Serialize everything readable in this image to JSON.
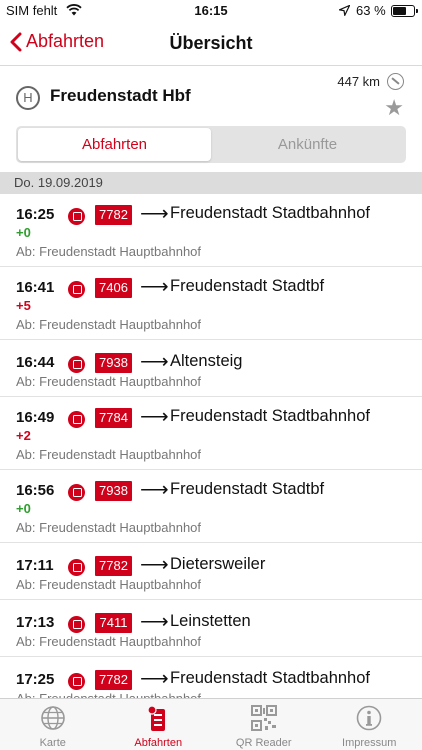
{
  "status_bar": {
    "carrier": "SIM fehlt",
    "time": "16:15",
    "battery_pct": "63 %",
    "battery_level": 0.63
  },
  "nav": {
    "back_label": "Abfahrten",
    "title": "Übersicht"
  },
  "station": {
    "icon": "H",
    "name": "Freudenstadt Hbf",
    "distance": "447 km"
  },
  "segments": {
    "departures": "Abfahrten",
    "arrivals": "Ankünfte",
    "active": "departures"
  },
  "date_header": "Do. 19.09.2019",
  "departures": [
    {
      "time": "16:25",
      "delay": "+0",
      "line": "7782",
      "destination": "Freudenstadt Stadtbahnhof",
      "from": "Ab: Freudenstadt Hauptbahnhof"
    },
    {
      "time": "16:41",
      "delay": "+5",
      "line": "7406",
      "destination": "Freudenstadt Stadtbf",
      "from": "Ab: Freudenstadt Hauptbahnhof"
    },
    {
      "time": "16:44",
      "delay": "",
      "line": "7938",
      "destination": "Altensteig",
      "from": "Ab: Freudenstadt Hauptbahnhof"
    },
    {
      "time": "16:49",
      "delay": "+2",
      "line": "7784",
      "destination": "Freudenstadt Stadtbahnhof",
      "from": "Ab: Freudenstadt Hauptbahnhof"
    },
    {
      "time": "16:56",
      "delay": "+0",
      "line": "7938",
      "destination": "Freudenstadt Stadtbf",
      "from": "Ab: Freudenstadt Hauptbahnhof"
    },
    {
      "time": "17:11",
      "delay": "",
      "line": "7782",
      "destination": "Dietersweiler",
      "from": "Ab: Freudenstadt Hauptbahnhof"
    },
    {
      "time": "17:13",
      "delay": "",
      "line": "7411",
      "destination": "Leinstetten",
      "from": "Ab: Freudenstadt Hauptbahnhof"
    },
    {
      "time": "17:25",
      "delay": "",
      "line": "7782",
      "destination": "Freudenstadt Stadtbahnhof",
      "from": "Ab: Freudenstadt Hauptbahnhof"
    }
  ],
  "tabs": [
    {
      "label": "Karte",
      "icon": "globe-icon"
    },
    {
      "label": "Abfahrten",
      "icon": "departures-icon"
    },
    {
      "label": "QR Reader",
      "icon": "qr-code-icon"
    },
    {
      "label": "Impressum",
      "icon": "info-icon"
    }
  ],
  "colors": {
    "accent": "#d0021b",
    "delay_on_time": "#2e9e2e",
    "delay_late": "#d0021b"
  }
}
